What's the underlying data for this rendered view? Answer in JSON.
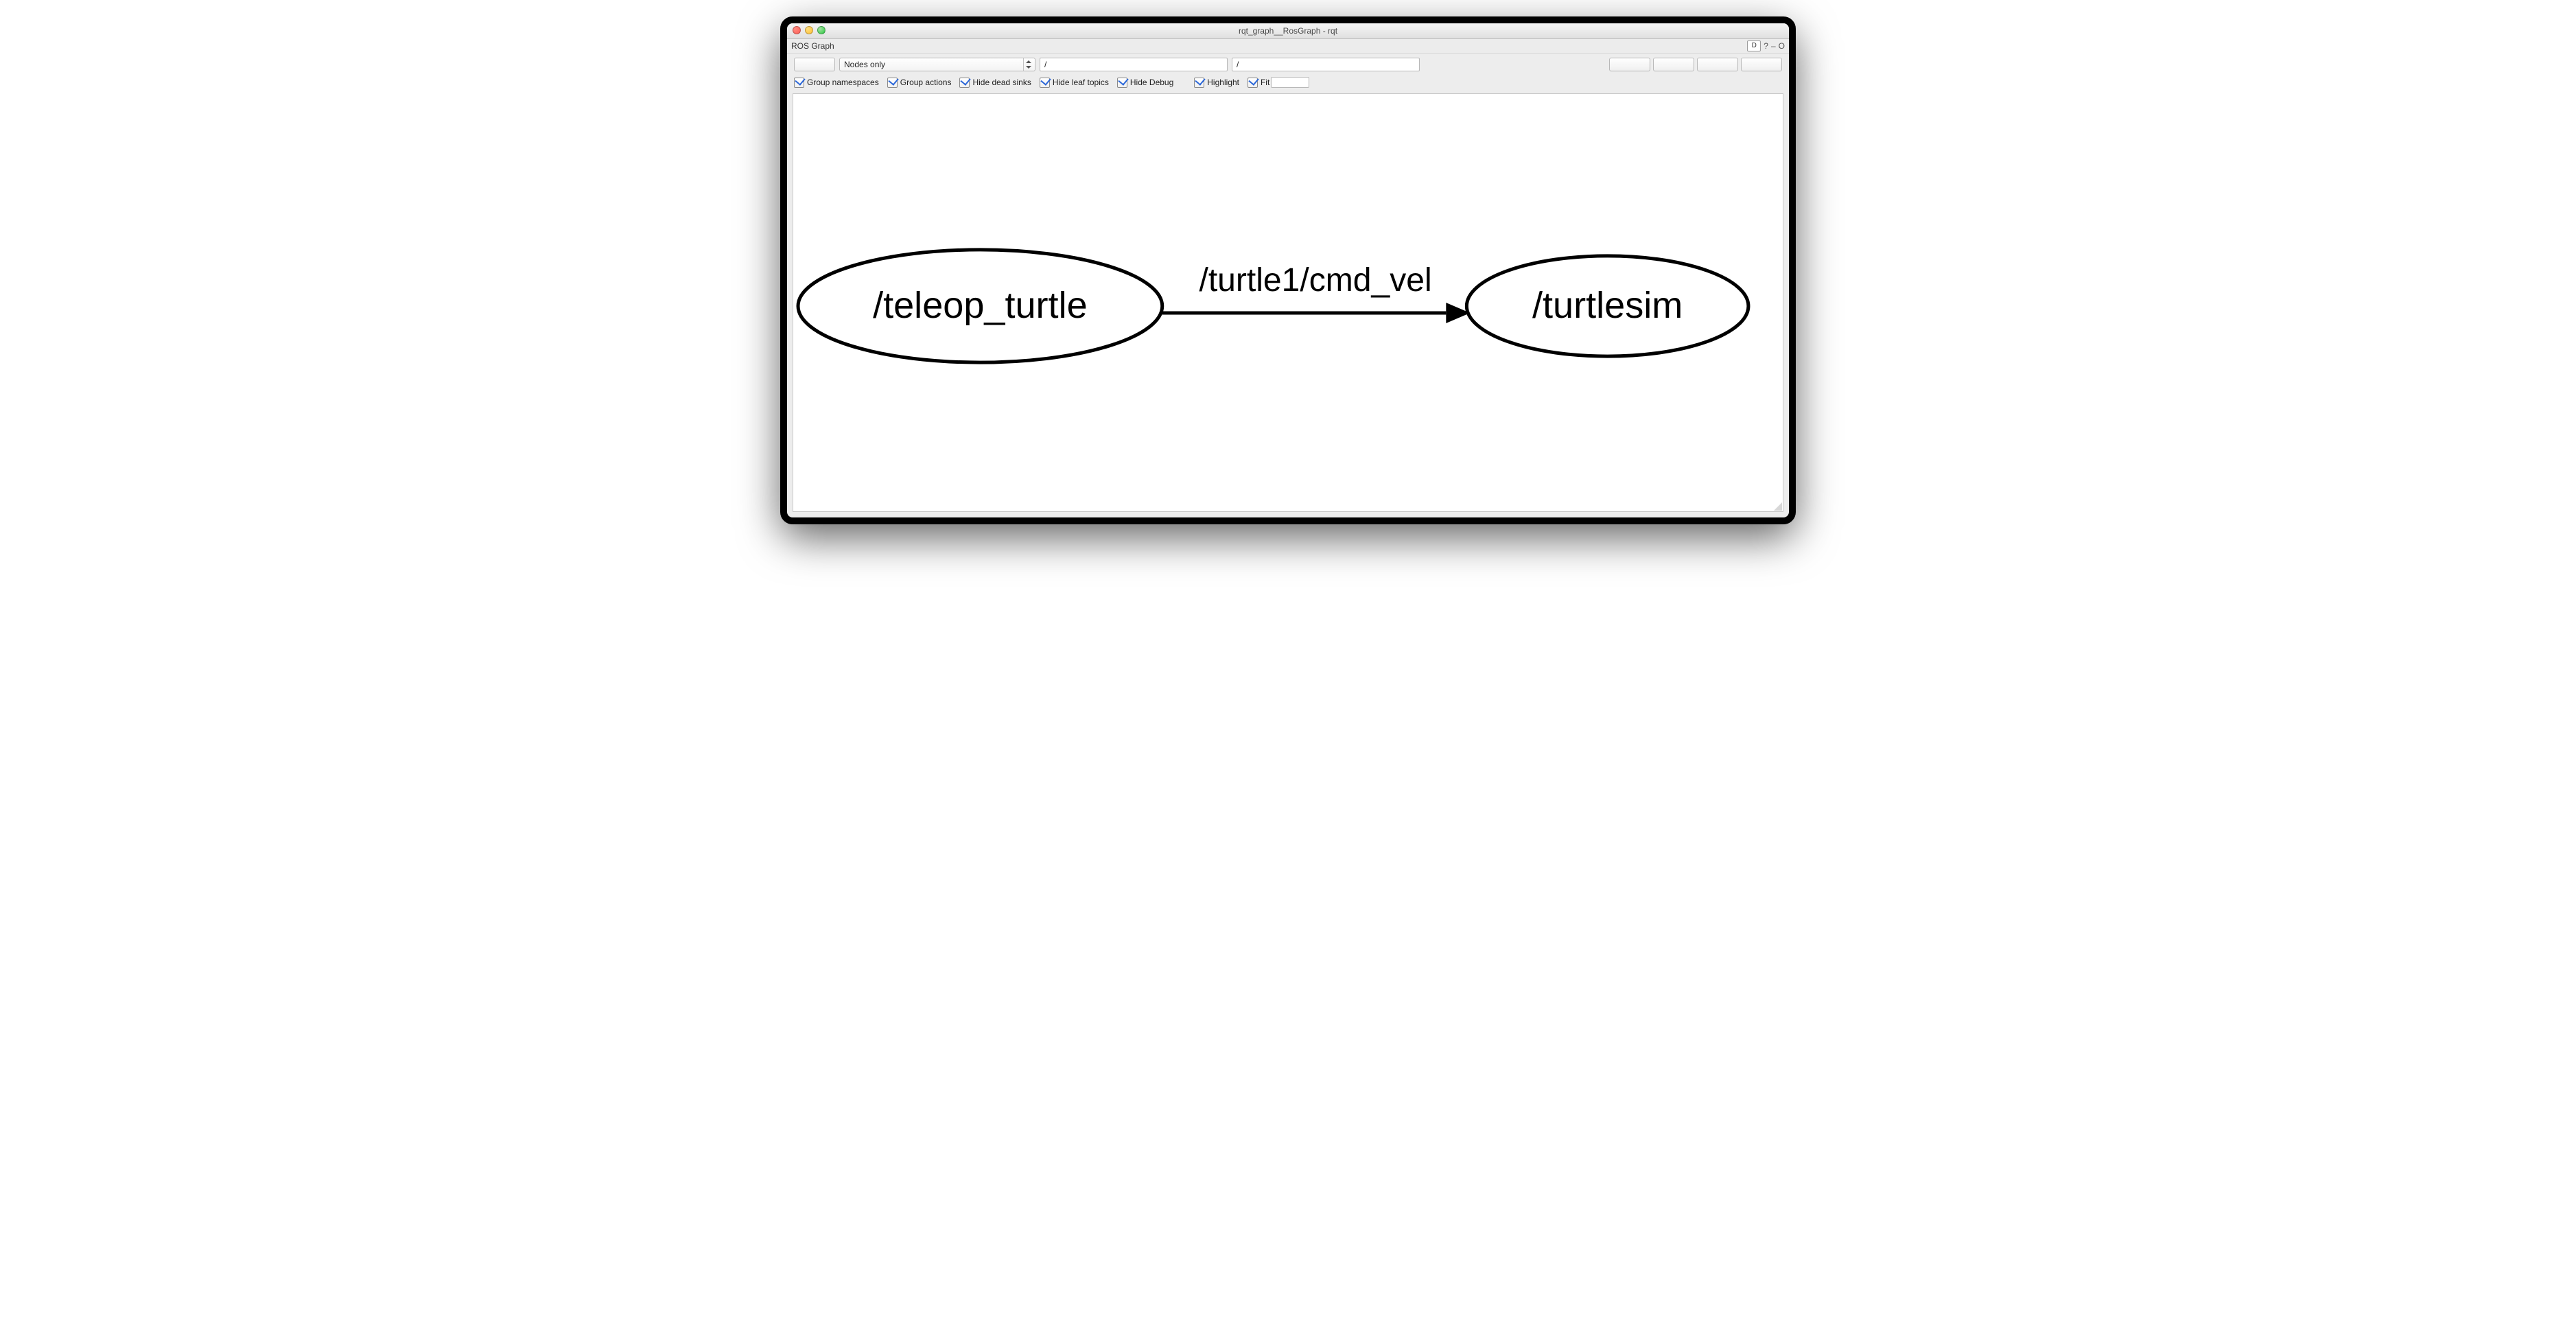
{
  "window": {
    "title": "rqt_graph__RosGraph - rqt"
  },
  "plugin": {
    "title": "ROS Graph",
    "dock_label": "D",
    "help_label": "?",
    "float_label": "–",
    "close_label": "O"
  },
  "toolbar": {
    "mode_selected": "Nodes only",
    "node_filter": "/",
    "topic_filter": "/"
  },
  "checks": {
    "group_namespaces": "Group namespaces",
    "group_actions": "Group actions",
    "hide_dead_sinks": "Hide dead sinks",
    "hide_leaf_topics": "Hide leaf topics",
    "hide_debug": "Hide Debug",
    "highlight": "Highlight",
    "fit": "Fit"
  },
  "graph": {
    "nodes": [
      {
        "id": "teleop_turtle",
        "label": "/teleop_turtle"
      },
      {
        "id": "turtlesim",
        "label": "/turtlesim"
      }
    ],
    "edges": [
      {
        "from": "teleop_turtle",
        "to": "turtlesim",
        "label": "/turtle1/cmd_vel"
      }
    ]
  },
  "chart_data": {
    "type": "diagram",
    "graph_kind": "directed",
    "nodes": [
      {
        "id": "/teleop_turtle"
      },
      {
        "id": "/turtlesim"
      }
    ],
    "edges": [
      {
        "from": "/teleop_turtle",
        "to": "/turtlesim",
        "label": "/turtle1/cmd_vel"
      }
    ],
    "title": "ROS Graph"
  }
}
